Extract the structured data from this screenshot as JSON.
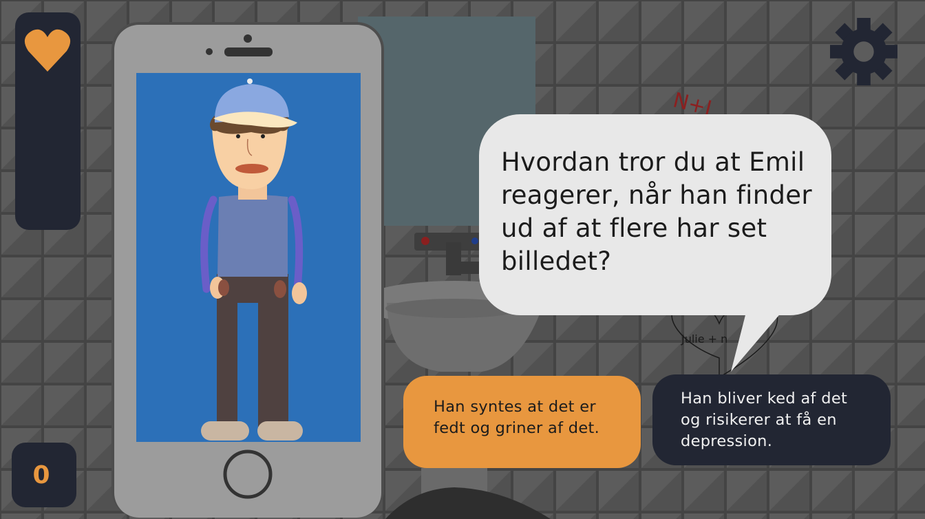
{
  "hud": {
    "health_icon": "heart-icon",
    "score": "0",
    "settings_icon": "gear-icon"
  },
  "scene": {
    "graffiti_top": "N+J",
    "graffiti_heart": "Julie +      n"
  },
  "dialog": {
    "question": "Hvordan tror du at Emil\nreagerer, når han finder\nud af at flere har set\nbilledet?",
    "answers": [
      "Han syntes at det er\nfedt og griner af det.",
      "Han bliver ked af det\nog risikerer at få en\ndepression."
    ]
  },
  "colors": {
    "accent": "#e8973f",
    "panel": "#222633",
    "phone_screen": "#2c70b8",
    "tile": "#5a5a5a"
  }
}
